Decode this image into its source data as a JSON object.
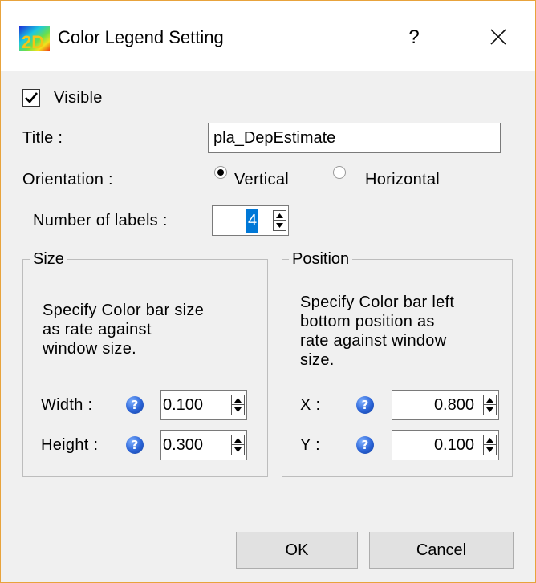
{
  "window": {
    "title": "Color Legend Setting",
    "help_label": "?",
    "close_icon": "close-icon",
    "app_icon": "app-2d-icon",
    "border_color": "#e8a33c"
  },
  "visible": {
    "label": "Visible",
    "checked": true
  },
  "title_field": {
    "label": "Title :",
    "value": "pla_DepEstimate"
  },
  "orientation": {
    "label": "Orientation :",
    "options": [
      {
        "label": "Vertical",
        "selected": true
      },
      {
        "label": "Horizontal",
        "selected": false
      }
    ]
  },
  "labels_count": {
    "label": "Number of labels :",
    "value": "4"
  },
  "size_group": {
    "title": "Size",
    "description": [
      "Specify Color bar size",
      "as rate against",
      "window size."
    ],
    "width": {
      "label": "Width :",
      "value": "0.100"
    },
    "height": {
      "label": "Height :",
      "value": "0.300"
    }
  },
  "position_group": {
    "title": "Position",
    "description": [
      "Specify Color bar left",
      "bottom position as",
      "rate against window",
      "size."
    ],
    "x": {
      "label": "X :",
      "value": "0.800"
    },
    "y": {
      "label": "Y :",
      "value": "0.100"
    }
  },
  "buttons": {
    "ok": "OK",
    "cancel": "Cancel"
  },
  "help_icon_glyph": "?"
}
